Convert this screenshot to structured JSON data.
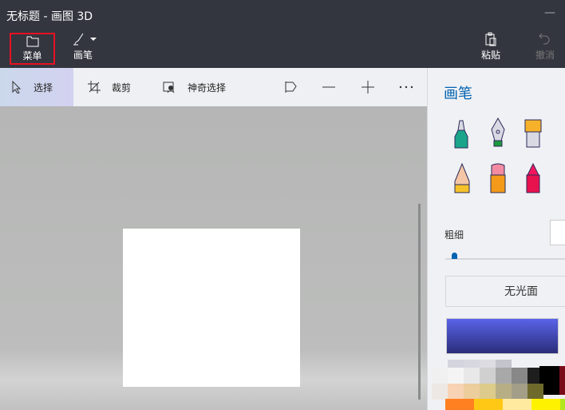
{
  "window": {
    "title": "无标题 - 画图 3D",
    "minimize": "—"
  },
  "topbar": {
    "menu": "菜单",
    "brushes": "画笔",
    "paste": "粘贴",
    "undo": "撤消"
  },
  "toolbar": {
    "select": "选择",
    "crop": "裁剪",
    "magic_select": "神奇选择"
  },
  "panel": {
    "title": "画笔",
    "thickness_label": "粗细",
    "thickness_value": 0.05,
    "finish": "无光面",
    "accent": "#0063b1"
  }
}
